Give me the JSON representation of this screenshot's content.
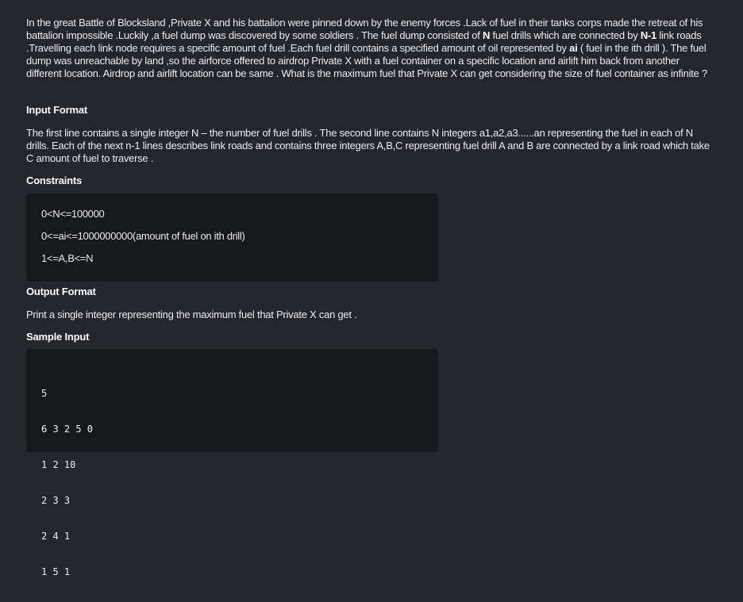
{
  "problem": {
    "statement": {
      "part1": "In the great Battle of Blocksland ,Private X and his battalion were pinned down by the enemy forces .Lack of fuel in their tanks corps made the retreat of his battalion impossible .Luckily ,a fuel dump was discovered by some soldiers . The fuel dump consisted of ",
      "bold_n": "N",
      "part2": " fuel drills which are connected by ",
      "bold_n1": "N-1",
      "part3": " link roads .Travelling each link node requires a specific amount of fuel .Each fuel drill contains a specified amount of oil represented by ",
      "bold_ai": "ai",
      "part4": " ( fuel in the ith drill ). The fuel dump was unreachable by land ,so the airforce offered to airdrop Private X with a fuel container on a specific location and airlift him back from another different location. Airdrop and airlift location can be same . What is the maximum fuel that Private X can get considering the size of fuel container as infinite ?"
    },
    "input_format": {
      "title": "Input Format",
      "text": "The first line contains a single integer N – the number of fuel drills . The second line contains N integers a1,a2,a3......an representing the fuel in each of N drills. Each of the next n-1 lines describes link roads and contains three integers A,B,C representing fuel drill A and B are connected by a link road which take C amount of fuel to traverse ."
    },
    "constraints": {
      "title": "Constraints",
      "items": [
        "0<N<=100000",
        "0<=ai<=1000000000(amount of fuel on ith drill)",
        "1<=A,B<=N"
      ]
    },
    "output_format": {
      "title": "Output Format",
      "text": "Print a single integer representing the maximum fuel that Private X can get ."
    },
    "sample_input": {
      "title": "Sample Input",
      "lines": [
        "5",
        "6 3 2 5 0",
        "1 2 10",
        "2 3 3",
        "2 4 1",
        "1 5 1"
      ]
    }
  }
}
